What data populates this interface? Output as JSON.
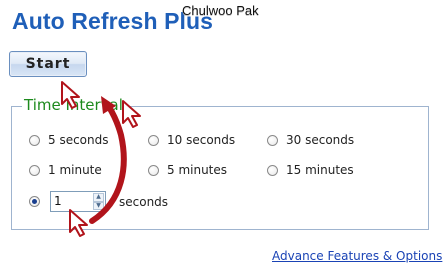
{
  "header": {
    "title": "Auto Refresh Plus",
    "author": "Chulwoo Pak"
  },
  "controls": {
    "start_label": "Start"
  },
  "interval": {
    "legend": "Time Interval",
    "presets": [
      {
        "label": "5 seconds",
        "selected": false
      },
      {
        "label": "10 seconds",
        "selected": false
      },
      {
        "label": "30 seconds",
        "selected": false
      },
      {
        "label": "1 minute",
        "selected": false
      },
      {
        "label": "5 minutes",
        "selected": false
      },
      {
        "label": "15 minutes",
        "selected": false
      }
    ],
    "custom": {
      "selected": true,
      "value": "1",
      "unit_label": "seconds"
    }
  },
  "footer": {
    "advanced_link": "Advance Features & Options"
  },
  "annotation": {
    "arrow_color": "#b1141b",
    "cursor_icons": [
      "cursor-arrow-icon",
      "cursor-arrow-icon",
      "cursor-arrow-icon"
    ]
  }
}
